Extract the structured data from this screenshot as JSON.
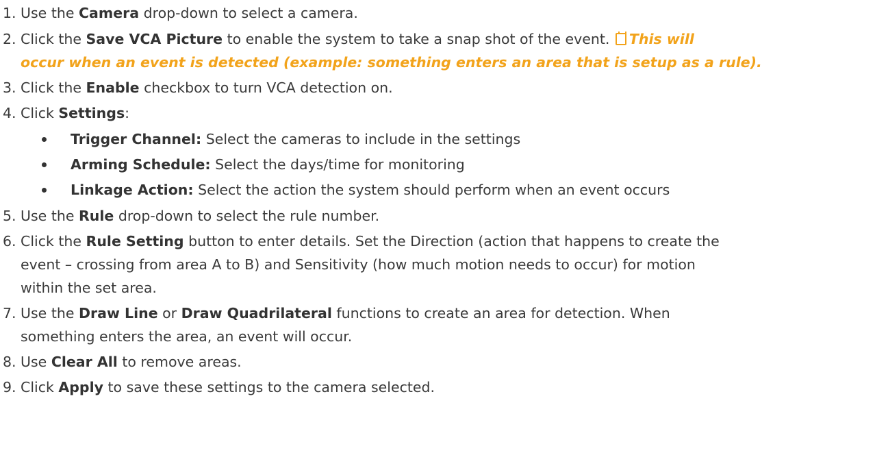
{
  "steps": {
    "s1": {
      "num": "1.",
      "pre": "Use the ",
      "b1": "Camera",
      "post": " drop-down to select a camera."
    },
    "s2": {
      "num": "2.",
      "pre": "Click the ",
      "b1": "Save VCA Picture",
      "post": " to enable the system to take a snap shot of the event. ",
      "note_line1": "This will",
      "note_line2": "occur when an event is detected (example: something enters an area that is setup as a rule)."
    },
    "s3": {
      "num": "3.",
      "pre": "Click the ",
      "b1": "Enable",
      "post": " checkbox to turn VCA detection on."
    },
    "s4": {
      "num": "4.",
      "pre": "Click ",
      "b1": "Settings",
      "post": ":"
    },
    "s5": {
      "num": "5.",
      "pre": "Use the ",
      "b1": "Rule",
      "post": " drop-down to select the rule number."
    },
    "s6": {
      "num": "6.",
      "pre": "Click the ",
      "b1": "Rule Setting",
      "post": " button to enter details. Set the Direction (action that happens to create the",
      "line2": "event – crossing from area A to B) and Sensitivity (how much motion needs to occur) for motion",
      "line3": "within the set area."
    },
    "s7": {
      "num": "7.",
      "pre": "Use the ",
      "b1": "Draw Line",
      "mid": " or ",
      "b2": "Draw Quadrilateral",
      "post": " functions to create an area for detection. When",
      "line2": "something enters the area, an event will occur."
    },
    "s8": {
      "num": "8.",
      "pre": "Use ",
      "b1": "Clear All",
      "post": " to remove areas."
    },
    "s9": {
      "num": "9.",
      "pre": "Click ",
      "b1": "Apply",
      "post": " to save these settings to the camera selected."
    }
  },
  "settings_bullets": [
    {
      "label": "Trigger Channel:",
      "text": " Select the cameras to include in the settings"
    },
    {
      "label": "Arming Schedule:",
      "text": " Select the days/time for monitoring"
    },
    {
      "label": "Linkage Action:",
      "text": " Select the action the system should perform when an event occurs"
    }
  ],
  "colors": {
    "note": "#f2a31b",
    "text": "#3a3a3a"
  },
  "icons": {
    "note": "note-icon"
  }
}
